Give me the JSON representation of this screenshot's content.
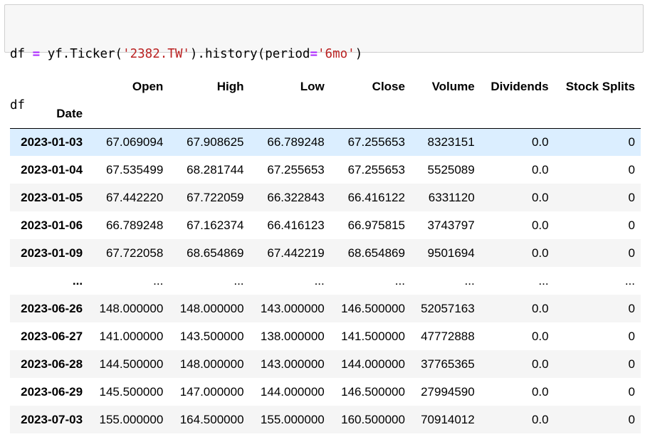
{
  "code": {
    "line1": {
      "p1": "df ",
      "eq": "=",
      "p2": " yf.Ticker(",
      "s1": "'2382.TW'",
      "p3": ").history(period",
      "eq2": "=",
      "s2": "'6mo'",
      "p4": ")"
    },
    "line2": "df"
  },
  "table": {
    "index_name": "Date",
    "columns": [
      "Open",
      "High",
      "Low",
      "Close",
      "Volume",
      "Dividends",
      "Stock Splits"
    ],
    "rows": [
      {
        "date": "2023-01-03",
        "values": [
          "67.069094",
          "67.908625",
          "66.789248",
          "67.255653",
          "8323151",
          "0.0",
          "0"
        ]
      },
      {
        "date": "2023-01-04",
        "values": [
          "67.535499",
          "68.281744",
          "67.255653",
          "67.255653",
          "5525089",
          "0.0",
          "0"
        ]
      },
      {
        "date": "2023-01-05",
        "values": [
          "67.442220",
          "67.722059",
          "66.322843",
          "66.416122",
          "6331120",
          "0.0",
          "0"
        ]
      },
      {
        "date": "2023-01-06",
        "values": [
          "66.789248",
          "67.162374",
          "66.416123",
          "66.975815",
          "3743797",
          "0.0",
          "0"
        ]
      },
      {
        "date": "2023-01-09",
        "values": [
          "67.722058",
          "68.654869",
          "67.442219",
          "68.654869",
          "9501694",
          "0.0",
          "0"
        ]
      },
      {
        "date": "...",
        "values": [
          "...",
          "...",
          "...",
          "...",
          "...",
          "...",
          "..."
        ]
      },
      {
        "date": "2023-06-26",
        "values": [
          "148.000000",
          "148.000000",
          "143.000000",
          "146.500000",
          "52057163",
          "0.0",
          "0"
        ]
      },
      {
        "date": "2023-06-27",
        "values": [
          "141.000000",
          "143.500000",
          "138.000000",
          "141.500000",
          "47772888",
          "0.0",
          "0"
        ]
      },
      {
        "date": "2023-06-28",
        "values": [
          "144.500000",
          "148.000000",
          "143.000000",
          "144.000000",
          "37765365",
          "0.0",
          "0"
        ]
      },
      {
        "date": "2023-06-29",
        "values": [
          "145.500000",
          "147.000000",
          "144.000000",
          "146.500000",
          "27994590",
          "0.0",
          "0"
        ]
      },
      {
        "date": "2023-07-03",
        "values": [
          "155.000000",
          "164.500000",
          "155.000000",
          "160.500000",
          "70914012",
          "0.0",
          "0"
        ]
      }
    ]
  },
  "colors": {
    "highlight_row": "#dbeeff",
    "odd_row": "#f5f5f5",
    "code_bg": "#f7f7f7",
    "string": "#ba2121",
    "operator": "#aa22ff"
  }
}
